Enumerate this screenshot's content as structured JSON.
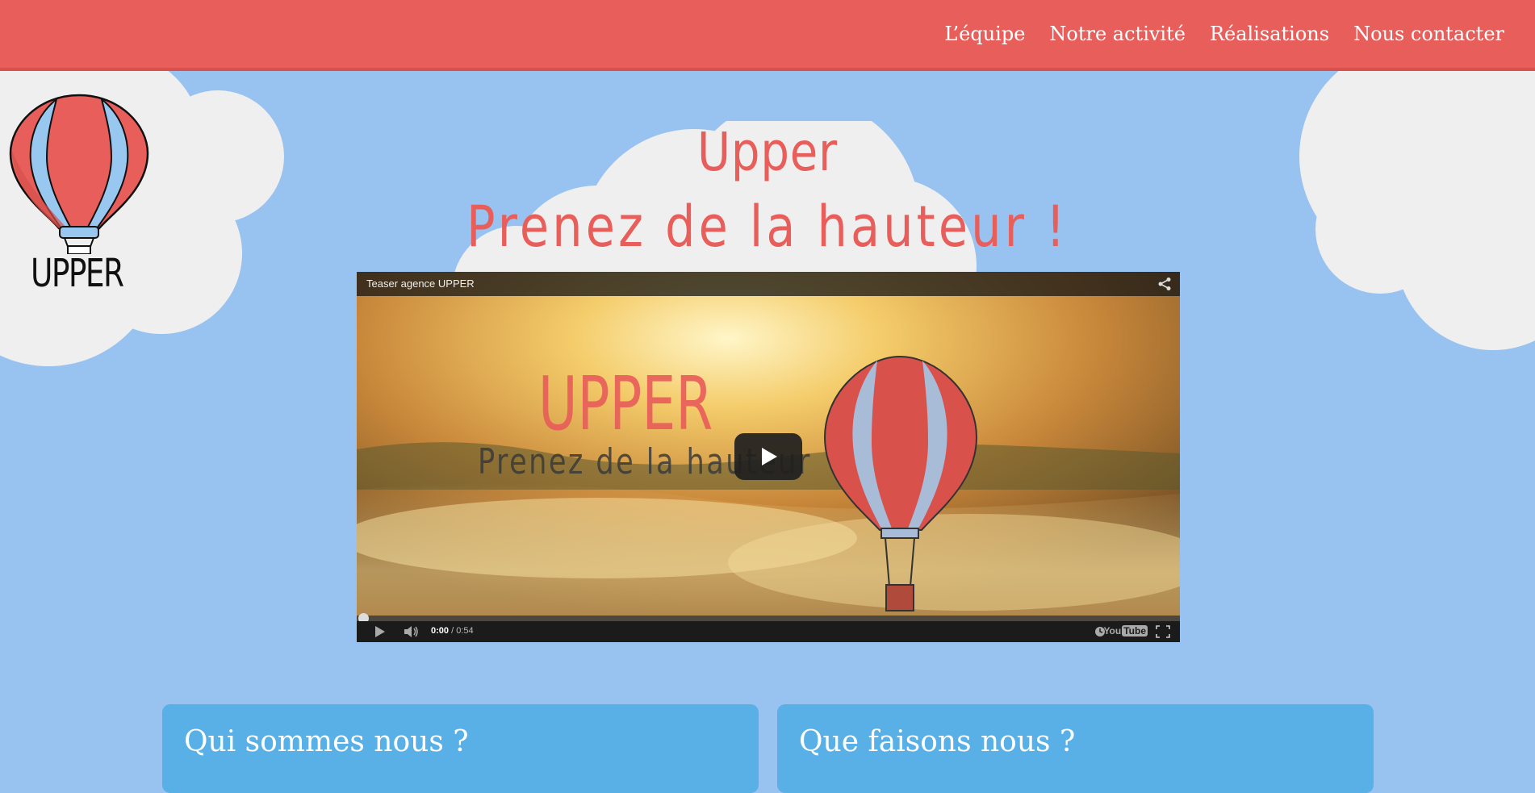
{
  "colors": {
    "brand_red": "#e85e5a",
    "sky_blue": "#98c2f0",
    "card_blue": "#58b0e6",
    "cloud": "#efefef"
  },
  "nav": {
    "items": [
      {
        "label": "L’équipe"
      },
      {
        "label": "Notre activité"
      },
      {
        "label": "Réalisations"
      },
      {
        "label": "Nous contacter"
      }
    ]
  },
  "logo": {
    "icon": "hot-air-balloon-icon",
    "text": "UPPER"
  },
  "hero": {
    "title": "Upper",
    "subtitle": "Prenez de la hauteur !"
  },
  "video": {
    "title": "Teaser agence UPPER",
    "frame_text_1": "UPPER",
    "frame_text_2": "Prenez de la hauteur",
    "time_current": "0:00",
    "time_separator": " / ",
    "time_total": "0:54",
    "youtube_label_you": "You",
    "youtube_label_tube": "Tube",
    "progress": 0
  },
  "cards": [
    {
      "title": "Qui sommes nous ?"
    },
    {
      "title": "Que faisons nous ?"
    }
  ]
}
